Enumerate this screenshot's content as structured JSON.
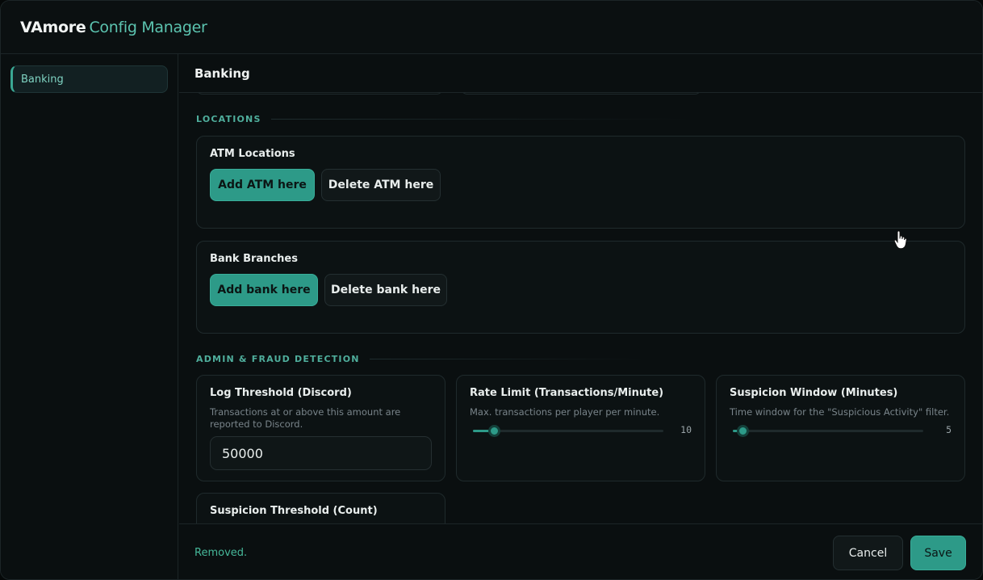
{
  "app": {
    "brand": "VAmore",
    "title": "Config Manager"
  },
  "sidebar": {
    "items": [
      {
        "label": "Banking"
      }
    ]
  },
  "main": {
    "header": "Banking",
    "sections": {
      "locations": "LOCATIONS",
      "admin": "ADMIN & FRAUD DETECTION"
    },
    "atm": {
      "title": "ATM Locations",
      "add_label": "Add ATM here",
      "delete_label": "Delete ATM here"
    },
    "bank": {
      "title": "Bank Branches",
      "add_label": "Add bank here",
      "delete_label": "Delete bank here"
    },
    "log_threshold": {
      "title": "Log Threshold (Discord)",
      "description": "Transactions at or above this amount are reported to Discord.",
      "value": "50000"
    },
    "rate_limit": {
      "title": "Rate Limit (Transactions/Minute)",
      "description": "Max. transactions per player per minute.",
      "value": "10",
      "fill_fraction": 0.11
    },
    "suspicion_window": {
      "title": "Suspicion Window (Minutes)",
      "description": "Time window for the \"Suspicious Activity\" filter.",
      "value": "5",
      "fill_fraction": 0.05
    },
    "suspicion_threshold": {
      "title": "Suspicion Threshold (Count)"
    }
  },
  "footer": {
    "status": "Removed.",
    "cancel_label": "Cancel",
    "save_label": "Save"
  },
  "colors": {
    "accent": "#2d9a88",
    "accent_text": "#5cc4b0",
    "background": "#0a0f10"
  },
  "icons": {
    "cursor": "hand-pointer-icon"
  }
}
